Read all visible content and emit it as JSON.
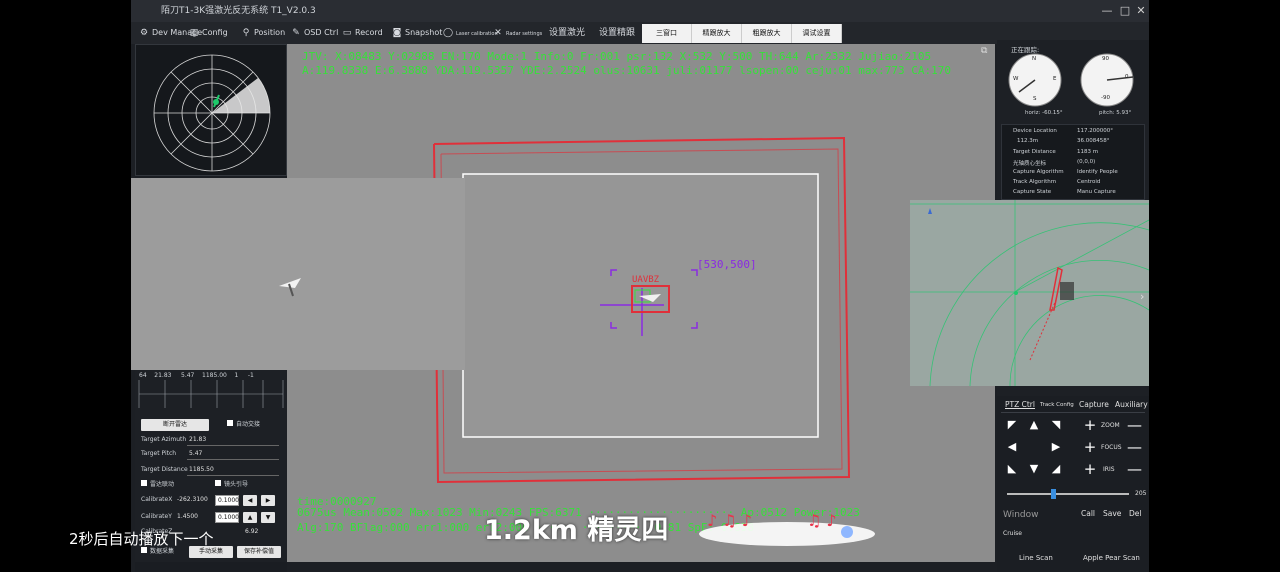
{
  "window": {
    "title": "陌刀T1-3K强激光反无系统 T1_V2.0.3",
    "controls": [
      "—",
      "□",
      "✕"
    ]
  },
  "toolbar": {
    "items": [
      {
        "icon": "gear-icon",
        "label": "Dev Manage"
      },
      {
        "icon": "config-icon",
        "label": "Config"
      },
      {
        "icon": "pin-icon",
        "label": "Position"
      },
      {
        "icon": "pencil-icon",
        "label": "OSD Ctrl"
      },
      {
        "icon": "record-icon",
        "label": "Record"
      },
      {
        "icon": "camera-icon",
        "label": "Snapshot"
      },
      {
        "icon": "laser-icon",
        "label": "Laser calibration"
      },
      {
        "icon": "radar-icon",
        "label": "Radar settings"
      },
      {
        "icon": "",
        "label": "设置激光"
      },
      {
        "icon": "",
        "label": "设置精跟"
      }
    ],
    "tabs": [
      "三窗口",
      "精跟放大",
      "粗跟放大",
      "调试设置"
    ]
  },
  "hud": {
    "line1": "JTV: X:08483 Y:02988 EN:170 Mode:1 Info:0 Fr:001 psr:132 X:532 Y:500 TH:644 Ar:2332 Jujiao:2105",
    "line2": "A:119.8338 E:6.3888 YDA:119.5357 YDE:2.2524 olus:10631 juli:01177 lsopen:00 ceju:01 max:773 CA:170",
    "bottom1": "time:0000927",
    "bottom2": "0675us Mean:0502 Max:1023 Min:0243 FPS:6371 ······················ Ap:0512 Power:1023",
    "bottom3": "Alg:170 BFlag:000 err1:000 err2:000 ······ ·········· 0.81 SpE:-0.858",
    "target_coord": "[530,500]",
    "target_label": "UAVBZ"
  },
  "left_panel": {
    "table_row": [
      "64",
      "21.83",
      "5.47",
      "1185.00",
      "1",
      "-1"
    ],
    "open_radar_button": "断开雷达",
    "auto_tracking_label": "自动交接",
    "target_azimuth_label": "Target Azimuth",
    "target_azimuth_value": "21.83",
    "target_pitch_label": "Target Pitch",
    "target_pitch_value": "5.47",
    "target_distance_label": "Target Distance",
    "target_distance_value": "1185.50",
    "radar_link_label": "雷达联动",
    "lens_guide_label": "镜头引导",
    "calibrate_x_label": "CalibrateX",
    "calibrate_x_value": "-262.3100",
    "calibrate_x_step": "0.1000",
    "calibrate_y_label": "CalibrateY",
    "calibrate_y_value": "1.4500",
    "calibrate_y_step": "0.1000",
    "calibrate_z_label": "CalibrateZ",
    "calibrate_z_value": "6.92",
    "data_collect_label": "数据采集",
    "manual_collect_button": "手动采集",
    "save_compensation_button": "保存补偿值"
  },
  "right_panel": {
    "header": "正在跟踪:",
    "compass1_dirs": [
      "N",
      "W",
      "E",
      "S"
    ],
    "compass1_reading": "horiz: -60.15°",
    "compass2_marks": [
      "90",
      "0",
      "-90"
    ],
    "compass2_reading": "pitch: 5.93°",
    "info": [
      {
        "label": "Device Location",
        "value": "117.200000°"
      },
      {
        "label": "112.3m",
        "value": "36.008458°"
      },
      {
        "label": "Target Distance",
        "value": "1183 m"
      },
      {
        "label": "光轴质心坐标",
        "value": "(0,0,0)"
      },
      {
        "label": "Capture Algorithm",
        "value": "Identify People"
      },
      {
        "label": "Track Algorithm",
        "value": "Centroid"
      },
      {
        "label": "Capture State",
        "value": "Manu Capture"
      }
    ],
    "ptz_tabs": [
      "PTZ Ctrl",
      "Track Config",
      "Capture",
      "Auxiliary"
    ],
    "ptz_labels": [
      "ZOOM",
      "FOCUS",
      "IRIS"
    ],
    "speed_value": "205",
    "bottom_buttons": [
      "Call",
      "Save",
      "Del"
    ],
    "window_label": "Window",
    "cruise_label": "Cruise",
    "line_scan_button": "Line Scan",
    "apple_scan_button": "Apple Pear Scan"
  },
  "caption": {
    "autoplay": "2秒后自动播放下一个",
    "subtitle": "1.2km 精灵四"
  },
  "colors": {
    "hud_green": "#37e03a",
    "track_red": "#e0303a",
    "reticle_purple": "#8a2be2",
    "radar_green": "#1ec96b"
  }
}
